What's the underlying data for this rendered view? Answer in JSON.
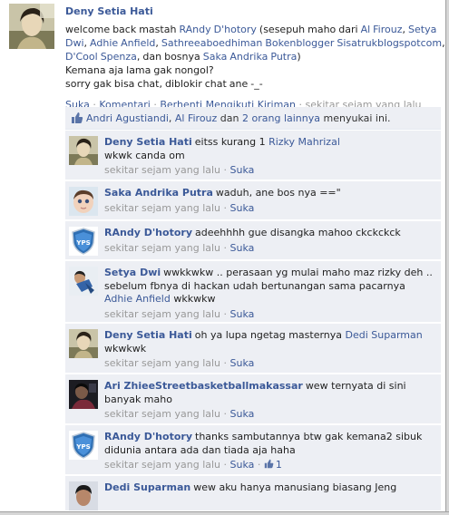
{
  "post": {
    "author": "Deny Setia Hati",
    "message_line1_prefix": "welcome back mastah ",
    "message_tag1": "RAndy D'hotory",
    "message_line1_mid": " (sesepuh maho dari ",
    "message_tag2": "Al Firouz",
    "message_sep1": ", ",
    "message_tag3": "Setya Dwi",
    "message_sep2": ", ",
    "message_tag4": "Adhie Anfield",
    "message_sep3": ", ",
    "message_tag5": "Sathreeaboedhiman Bokenblogger Sisatrukblogspotcom",
    "message_sep4": ", ",
    "message_tag6": "D'Cool Spenza",
    "message_sep5": ", dan bosnya ",
    "message_tag7": "Saka Andrika Putra",
    "message_end": ")",
    "message_line2": "Kemana aja lama gak nongol?",
    "message_line3": "sorry gak bisa chat, diblokir chat ane -_-",
    "actions": {
      "like": "Suka",
      "comment": "Komentari",
      "unfollow": "Berhenti Mengikuti Kiriman",
      "time": "sekitar sejam yang lalu",
      "sep": " · "
    }
  },
  "likes": {
    "person1": "Andri Agustiandi",
    "sep": ", ",
    "person2": "Al Firouz",
    "and": " dan ",
    "others": "2 orang lainnya",
    "suffix": " menyukai ini."
  },
  "comments": [
    {
      "author": "Deny Setia Hati",
      "text": "eitss kurang 1 ",
      "tag": "Rizky Mahrizal",
      "text2": "wkwk canda om",
      "time": "sekitar sejam yang lalu",
      "like": "Suka"
    },
    {
      "author": "Saka Andrika Putra",
      "text": "waduh, ane bos nya ==\"",
      "time": "sekitar sejam yang lalu",
      "like": "Suka"
    },
    {
      "author": "RAndy D'hotory",
      "text": "adeehhhh gue disangka mahoo ckckckck",
      "time": "sekitar sejam yang lalu",
      "like": "Suka"
    },
    {
      "author": "Setya Dwi",
      "text": "wwkkwkw .. perasaan yg mulai maho maz rizky deh .. sebelum fbnya di hackan udah bertunangan sama pacarnya ",
      "tag": "Adhie Anfield",
      "text2": " wkkwkw",
      "time": "sekitar sejam yang lalu",
      "like": "Suka"
    },
    {
      "author": "Deny Setia Hati",
      "text": "oh ya lupa ngetag masternya ",
      "tag": "Dedi Suparman",
      "text2": "wkwkwk",
      "time": "sekitar sejam yang lalu",
      "like": "Suka"
    },
    {
      "author": "Ari ZhieeStreetbasketballmakassar",
      "text": "wew ternyata di sini banyak maho",
      "time": "sekitar sejam yang lalu",
      "like": "Suka"
    },
    {
      "author": "RAndy D'hotory",
      "text": "thanks sambutannya btw gak kemana2 sibuk didunia antara ada dan tiada aja haha",
      "time": "sekitar sejam yang lalu",
      "like": "Suka",
      "like_count": "1"
    },
    {
      "author": "Dedi Suparman",
      "text": "wew aku hanya manusiang biasang Jeng"
    }
  ],
  "avatar_labels": {
    "yps": "YPS"
  },
  "colors": {
    "link": "#3b5998",
    "comment_bg": "#edeff4",
    "meta_gray": "#999999"
  }
}
